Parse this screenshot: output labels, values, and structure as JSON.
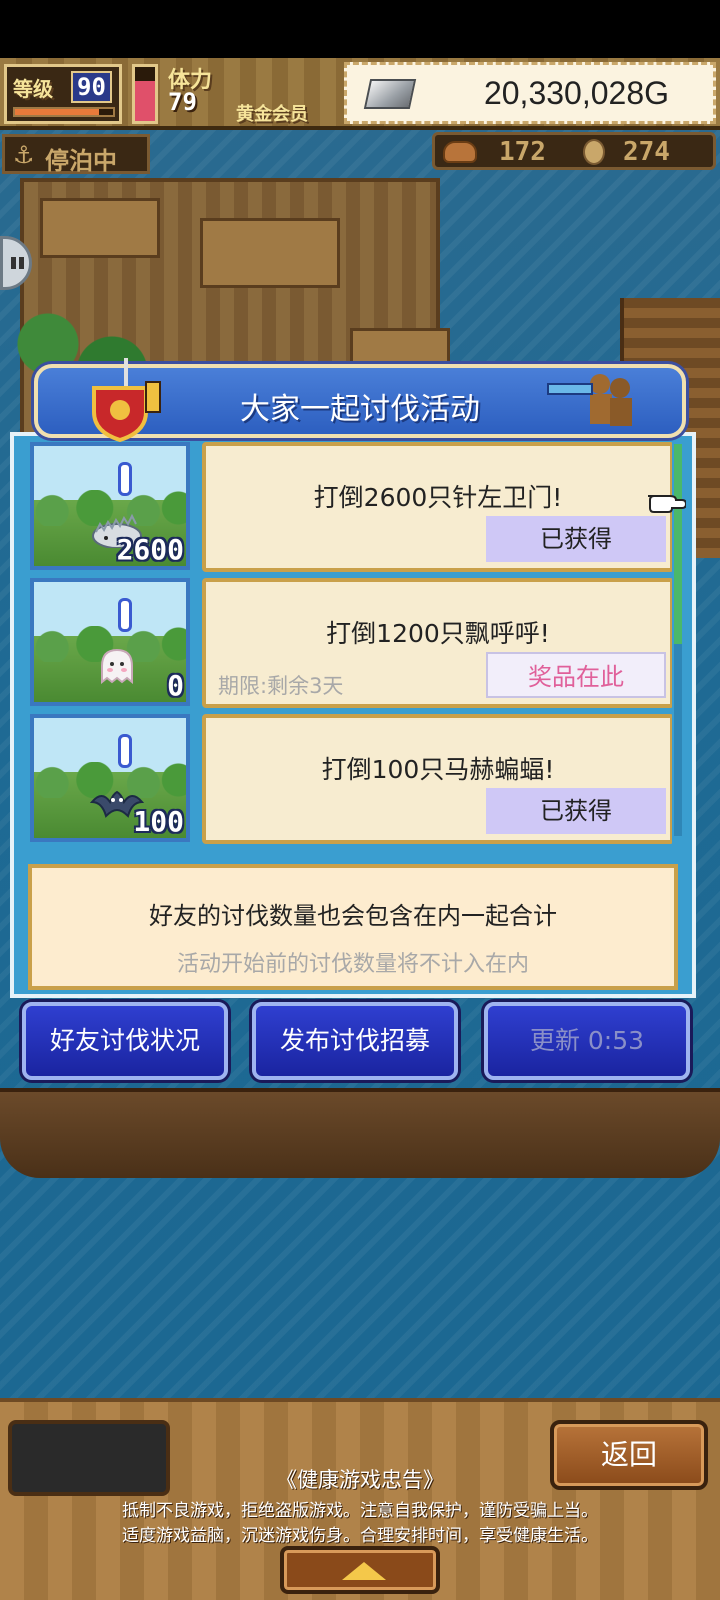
{
  "hud": {
    "level_label": "等级",
    "level_value": "90",
    "level_progress": 0.86,
    "stamina_label": "体力",
    "stamina_value": "79",
    "stamina_level": 0.75,
    "member_label": "黄金会员",
    "gold": "20,330,028G"
  },
  "status": {
    "anchor_label": "停泊中",
    "counter1": "172",
    "counter2": "274"
  },
  "dialog": {
    "title": "大家一起讨伐活动",
    "events": [
      {
        "title": "打倒2600只针左卫门!",
        "count": "2600",
        "deadline": "",
        "button": "已获得",
        "button_state": "claimed",
        "monster_icon": "hedgehog-monster-icon"
      },
      {
        "title": "打倒1200只飘呼呼!",
        "count": "0",
        "deadline": "期限:剩余3天",
        "button": "奖品在此",
        "button_state": "prize",
        "monster_icon": "ghost-monster-icon"
      },
      {
        "title": "打倒100只马赫蝙蝠!",
        "count": "100",
        "deadline": "",
        "button": "已获得",
        "button_state": "claimed",
        "monster_icon": "bat-monster-icon"
      }
    ],
    "info_main": "好友的讨伐数量也会包含在内一起合计",
    "info_note": "活动开始前的讨伐数量将不计入在内"
  },
  "actions": {
    "friend_status": "好友讨伐状况",
    "post_recruit": "发布讨伐招募",
    "refresh": "更新 0:53"
  },
  "footer": {
    "back": "返回",
    "health_title": "《健康游戏忠告》",
    "health_line1": "抵制不良游戏，拒绝盗版游戏。注意自我保护，谨防受骗上当。",
    "health_line2": "适度游戏益脑，沉迷游戏伤身。合理安排时间，享受健康生活。"
  },
  "colors": {
    "dialog_blue": "#2d5fc0",
    "claimed_button": "#cfc8f6",
    "prize_text": "#e0609a"
  }
}
